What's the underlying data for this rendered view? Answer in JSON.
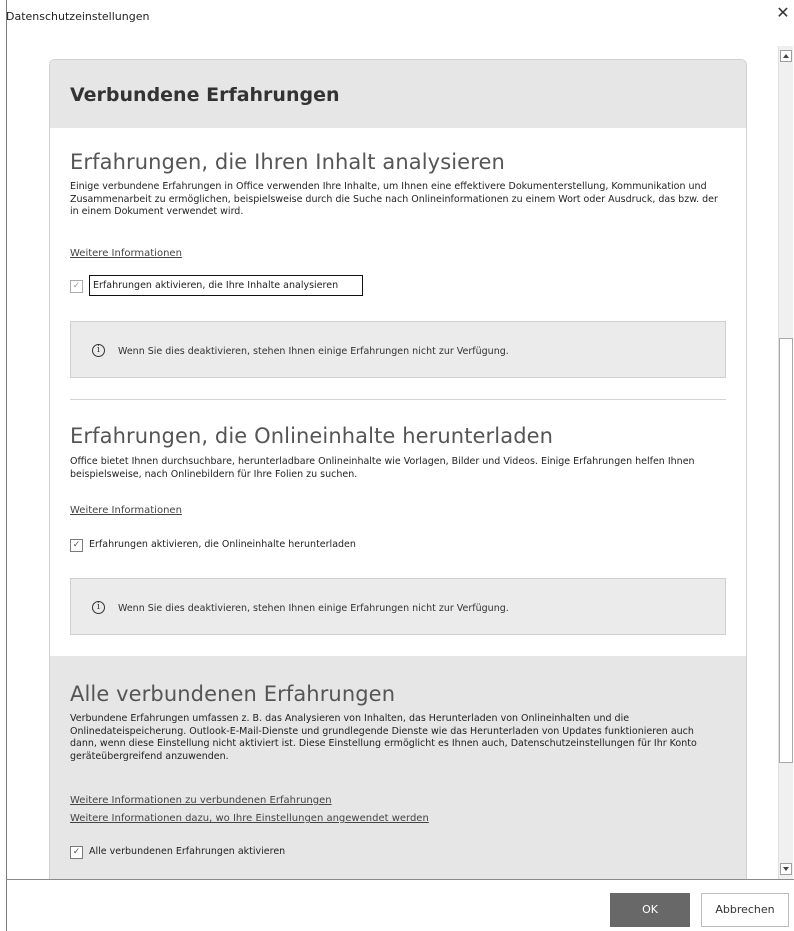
{
  "window": {
    "title": "Datenschutzeinstellungen",
    "close_glyph": "✕"
  },
  "card": {
    "header": "Verbundene Erfahrungen",
    "section1": {
      "heading": "Erfahrungen, die Ihren Inhalt analysieren",
      "description": "Einige verbundene Erfahrungen in Office verwenden Ihre Inhalte, um Ihnen eine effektivere Dokumenterstellung, Kommunikation und Zusammenarbeit zu ermöglichen, beispielsweise durch die Suche nach Onlineinformationen zu einem Wort oder Ausdruck, das bzw. der in einem Dokument verwendet wird.",
      "link": "Weitere Informationen",
      "checkbox_label": "Erfahrungen aktivieren, die Ihre Inhalte analysieren",
      "checkbox_checked": true,
      "info_text": "Wenn Sie dies deaktivieren, stehen Ihnen einige Erfahrungen nicht zur Verfügung."
    },
    "section2": {
      "heading": "Erfahrungen, die Onlineinhalte herunterladen",
      "description": "Office bietet Ihnen durchsuchbare, herunterladbare Onlineinhalte wie Vorlagen, Bilder und Videos. Einige Erfahrungen helfen Ihnen beispielsweise, nach Onlinebildern für Ihre Folien zu suchen.",
      "link": "Weitere Informationen",
      "checkbox_label": "Erfahrungen aktivieren, die Onlineinhalte herunterladen",
      "checkbox_checked": true,
      "info_text": "Wenn Sie dies deaktivieren, stehen Ihnen einige Erfahrungen nicht zur Verfügung."
    },
    "section3": {
      "heading": "Alle verbundenen Erfahrungen",
      "description": "Verbundene Erfahrungen umfassen z. B. das Analysieren von Inhalten, das Herunterladen von Onlineinhalten und die Onlinedateispeicherung. Outlook-E-Mail-Dienste und grundlegende Dienste wie das Herunterladen von Updates funktionieren auch dann, wenn diese Einstellung nicht aktiviert ist. Diese Einstellung ermöglicht es Ihnen auch, Datenschutzeinstellungen für Ihr Konto geräteübergreifend anzuwenden.",
      "link1": "Weitere Informationen zu verbundenen Erfahrungen",
      "link2": "Weitere Informationen dazu, wo Ihre Einstellungen angewendet werden",
      "checkbox_label": "Alle verbundenen Erfahrungen aktivieren",
      "checkbox_checked": true
    }
  },
  "glyphs": {
    "check": "✓",
    "info": "i"
  },
  "buttons": {
    "ok": "OK",
    "cancel": "Abbrechen"
  }
}
